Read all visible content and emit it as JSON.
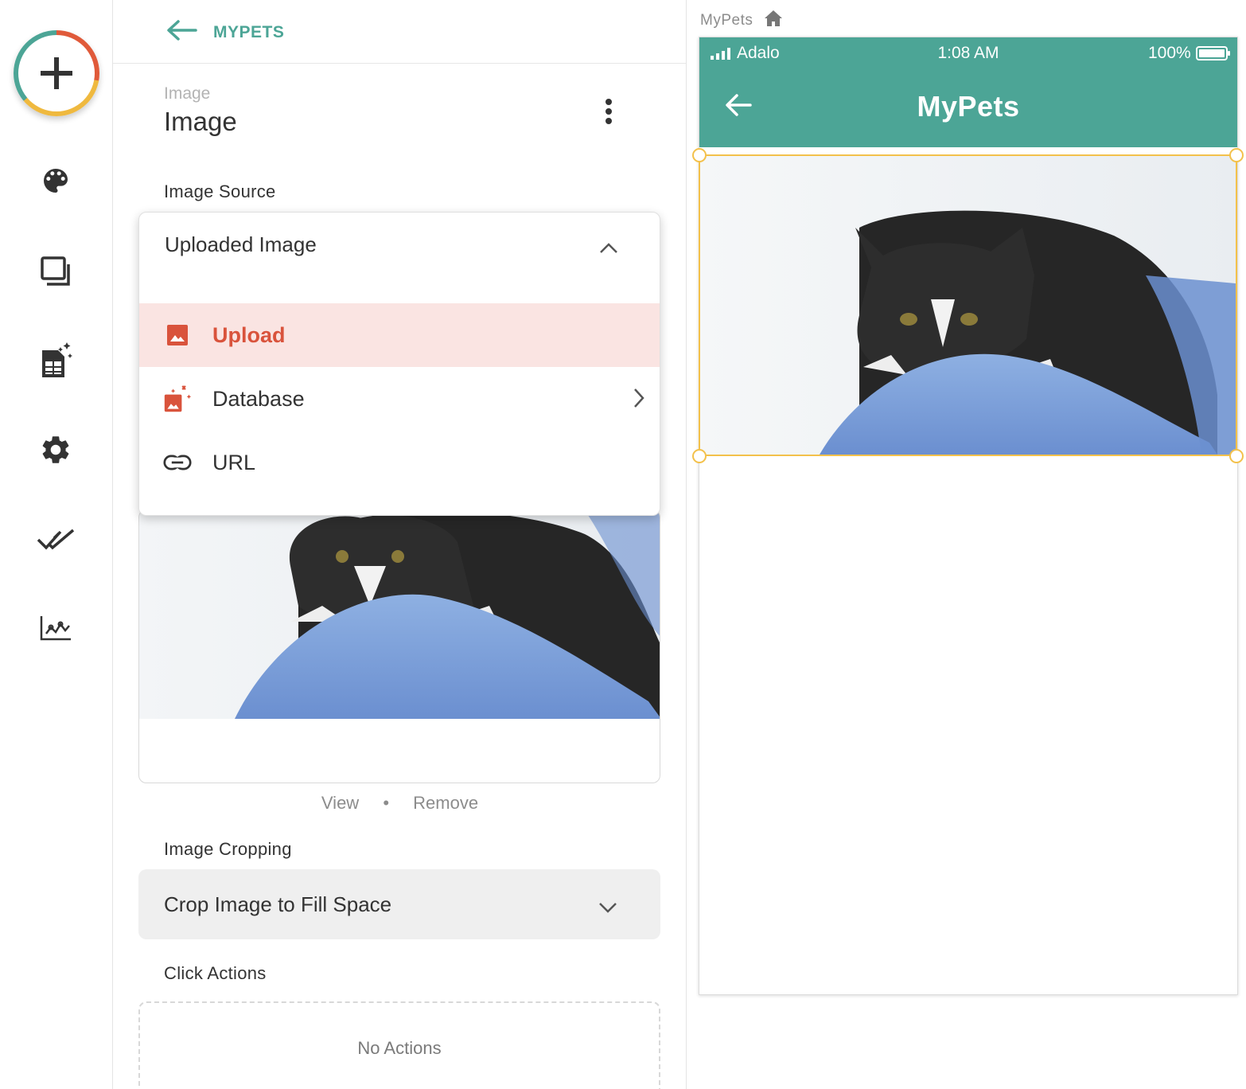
{
  "header": {
    "back_label": "MYPETS"
  },
  "component": {
    "type_label": "Image",
    "title": "Image"
  },
  "image_source": {
    "label": "Image Source",
    "selected": "Uploaded Image",
    "options": [
      {
        "label": "Upload",
        "icon": "image-icon",
        "active": true
      },
      {
        "label": "Database",
        "icon": "database-image-icon",
        "active": false
      },
      {
        "label": "URL",
        "icon": "link-icon",
        "active": false
      }
    ]
  },
  "preview_links": {
    "view": "View",
    "separator": "•",
    "remove": "Remove"
  },
  "image_cropping": {
    "label": "Image Cropping",
    "selected": "Crop Image to Fill Space"
  },
  "click_actions": {
    "label": "Click Actions",
    "empty_text": "No Actions"
  },
  "canvas": {
    "screen_name": "MyPets"
  },
  "device": {
    "carrier": "Adalo",
    "time": "1:08 AM",
    "battery": "100%",
    "screen_title": "MyPets"
  },
  "colors": {
    "accent": "#4ca596",
    "danger": "#d9533c",
    "selection": "#f3c14b",
    "active_bg": "#fae4e2"
  }
}
